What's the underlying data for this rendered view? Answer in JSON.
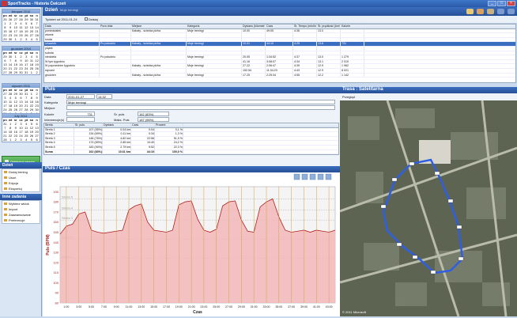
{
  "app": {
    "title": "SportTracks - Historia Ćwiczeń"
  },
  "calendars": [
    {
      "title": "listopad 2010",
      "days": [
        "pn",
        "wt",
        "śr",
        "cz",
        "pt",
        "so",
        "n",
        "25",
        "26",
        "27",
        "28",
        "29",
        "30",
        "31",
        "1",
        "2",
        "3",
        "4",
        "5",
        "6",
        "7",
        "8",
        "9",
        "10",
        "11",
        "12",
        "13",
        "14",
        "15",
        "16",
        "17",
        "18",
        "19",
        "20",
        "21",
        "22",
        "23",
        "24",
        "25",
        "26",
        "27",
        "28",
        "29",
        "30",
        "1",
        "2",
        "3",
        "4",
        "5"
      ]
    },
    {
      "title": "grudzień 2010",
      "days": [
        "pn",
        "wt",
        "śr",
        "cz",
        "pt",
        "so",
        "n",
        "29",
        "30",
        "1",
        "2",
        "3",
        "4",
        "5",
        "6",
        "7",
        "8",
        "9",
        "10",
        "11",
        "12",
        "13",
        "14",
        "15",
        "16",
        "17",
        "18",
        "19",
        "20",
        "21",
        "22",
        "23",
        "24",
        "25",
        "26",
        "27",
        "28",
        "29",
        "30",
        "31",
        "1",
        "2"
      ]
    },
    {
      "title": "styczeń 2011",
      "days": [
        "pn",
        "wt",
        "śr",
        "cz",
        "pt",
        "so",
        "n",
        "27",
        "28",
        "29",
        "30",
        "31",
        "1",
        "2",
        "3",
        "4",
        "5",
        "6",
        "7",
        "8",
        "9",
        "10",
        "11",
        "12",
        "13",
        "14",
        "15",
        "16",
        "17",
        "18",
        "19",
        "20",
        "21",
        "22",
        "23",
        "24",
        "25",
        "26",
        "27",
        "28",
        "29",
        "30",
        "31",
        "1",
        "2",
        "3",
        "4",
        "5",
        "6"
      ]
    },
    {
      "title": "luty 2011",
      "days": [
        "pn",
        "wt",
        "śr",
        "cz",
        "pt",
        "so",
        "n",
        "31",
        "1",
        "2",
        "3",
        "4",
        "5",
        "6",
        "7",
        "8",
        "9",
        "10",
        "11",
        "12",
        "13",
        "14",
        "15",
        "16",
        "17",
        "18",
        "19",
        "20",
        "21",
        "22",
        "23",
        "24",
        "25",
        "26",
        "27",
        "28",
        "1",
        "2",
        "3",
        "4",
        "5",
        "6"
      ]
    }
  ],
  "unlock_label": "Odblokuj wersję Pro",
  "panels": [
    {
      "title": "Dzień",
      "items": [
        "Dodaj trening",
        "Usuń",
        "Edycja",
        "Eksportuj"
      ]
    },
    {
      "title": "Inne zadania",
      "items": [
        "Wybierz widok",
        "Import",
        "Zaawansowane",
        "Preferencje"
      ]
    }
  ],
  "header": {
    "title": "Dzień",
    "dropdown": "Moje treningi"
  },
  "toolbar": {
    "week": "Tydzień od 2011-01-24",
    "dzis": "Dzisiaj"
  },
  "grid": {
    "columns": [
      "Data",
      "Pora dnia",
      "Miejsce",
      "Kategoria",
      "Dystans (kilometr)",
      "Czas",
      "Śr. Tempo (min/km)",
      "Śr. prędkość (km/h)",
      "Kalorie"
    ],
    "rows": [
      [
        "poniedziałek",
        "",
        "Kabaty - ścieżka piżha",
        "Moje treningi",
        "10.00",
        "49:05",
        "4:36",
        "13.0",
        ""
      ],
      [
        "wtorek",
        "",
        "",
        "",
        "",
        "",
        "",
        "",
        ""
      ],
      [
        "środa",
        "",
        "",
        "",
        "",
        "",
        "",
        "",
        ""
      ],
      [
        "czwartek",
        "Po południu",
        "Kabaty - ścieżka piżha",
        "Moje treningi",
        "10.01",
        "44:10",
        "4:25",
        "13.6",
        "731"
      ],
      [
        "piątek",
        "",
        "",
        "",
        "",
        "",
        "",
        "",
        ""
      ],
      [
        "sobota",
        "",
        "",
        "",
        "",
        "",
        "",
        "",
        ""
      ],
      [
        "niedziela",
        "Po południu",
        "",
        "Moje treningi",
        "20.05",
        "1:34:52",
        "4:37",
        "13.0",
        "1 279"
      ],
      [
        "W tym tygodniu",
        "",
        "",
        "",
        "41.16",
        "3:08:07",
        "4:34",
        "13.1",
        "2 010"
      ],
      [
        "W poprzednim tygodniu",
        "",
        "Kabaty - ścieżka piżha",
        "Moje treningi",
        "27.22",
        "2:06:47",
        "4:39",
        "12.9",
        "1 962"
      ],
      [
        "styczeń",
        "",
        "",
        "",
        "152.54",
        "11:34:23",
        "4:43",
        "12.9",
        "8 021"
      ],
      [
        "grudzień",
        "",
        "Kabaty - ścieżka piżha",
        "Moje treningi",
        "17.25",
        "2:25:34",
        "4:55",
        "12.2",
        "1 142"
      ]
    ]
  },
  "puls": {
    "title": "Puls",
    "labels": {
      "data": "Data",
      "kategoria": "Kategoria",
      "miejsce": "Miejsce",
      "kalorie": "Kalorie",
      "interwencje": "Interwencje(s)",
      "sr": "Śr. puls",
      "maks": "Maks. Puls"
    },
    "values": {
      "date": "2011-01-27",
      "time": "14:32",
      "kategoria": "Moje treningi",
      "kalorie": "731",
      "sr": "162 (83%)",
      "maks": "187 (96%)"
    },
    "zones_cols": [
      "Strefa",
      "Śr. puls",
      "Dystans",
      "Czas",
      "Procent"
    ],
    "zones": [
      [
        "Strefa 1",
        "107 (55%)",
        "0.04 km",
        "0:04",
        "0,1 %"
      ],
      [
        "Strefa 2",
        "134 (69%)",
        "0.11 km",
        "0:34",
        "1,3 %"
      ],
      [
        "Strefa 3",
        "148 (76%)",
        "4.82 km",
        "22:56",
        "51,9 %"
      ],
      [
        "Strefa 4",
        "173 (89%)",
        "2.85 km",
        "10:40",
        "24,2 %"
      ],
      [
        "Strefa 5",
        "183 (94%)",
        "2.79 km",
        "9:52",
        "22,3 %"
      ],
      [
        "Suma",
        "162 (83%)",
        "10.61 km",
        "44:10",
        "100,0 %"
      ]
    ]
  },
  "chart_title": "Puls / Czas",
  "chart_data": {
    "type": "area",
    "title": "",
    "xlabel": "Czas",
    "ylabel": "Puls (BPM)",
    "ylim": [
      80,
      195
    ],
    "yticks": [
      80,
      90,
      100,
      110,
      120,
      130,
      140,
      150,
      160,
      170,
      180,
      190
    ],
    "x": [
      0,
      1,
      2,
      3,
      4,
      5,
      6,
      7,
      8,
      9,
      10,
      11,
      12,
      13,
      14,
      15,
      16,
      17,
      18,
      19,
      20,
      21,
      22,
      23,
      24,
      25,
      26,
      27,
      28,
      29,
      30,
      31,
      32,
      33,
      34,
      35,
      36,
      37,
      38,
      39,
      40,
      41,
      42,
      43,
      44
    ],
    "xticks": [
      "1:00",
      "3:00",
      "5:00",
      "7:00",
      "9:00",
      "11:00",
      "13:00",
      "15:00",
      "17:00",
      "19:00",
      "21:00",
      "23:00",
      "25:00",
      "27:00",
      "29:00",
      "31:00",
      "33:00",
      "35:00",
      "37:00",
      "39:00",
      "41:00",
      "43:00"
    ],
    "series": [
      {
        "values": [
          148,
          156,
          158,
          168,
          170,
          152,
          150,
          149,
          150,
          151,
          152,
          172,
          176,
          178,
          160,
          152,
          151,
          150,
          152,
          177,
          180,
          181,
          163,
          152,
          150,
          153,
          176,
          180,
          181,
          162,
          151,
          150,
          175,
          180,
          183,
          165,
          152,
          150,
          151,
          152,
          150,
          152,
          151,
          150,
          152
        ]
      }
    ],
    "zone_labels": [
      "Strefa 5",
      "Strefa 4",
      "Strefa 3",
      "Strefa 2",
      "Strefa 1"
    ],
    "zone_values": [
      183,
      172,
      162,
      143,
      124
    ],
    "colors": {
      "fill": "#f2b7b7",
      "line": "#b12020",
      "vline": "#d4a040"
    }
  },
  "map": {
    "title": "Trasa : Satelitarna",
    "toolbar": "Przegląd",
    "attribution": "© 2011 Microsoft"
  }
}
